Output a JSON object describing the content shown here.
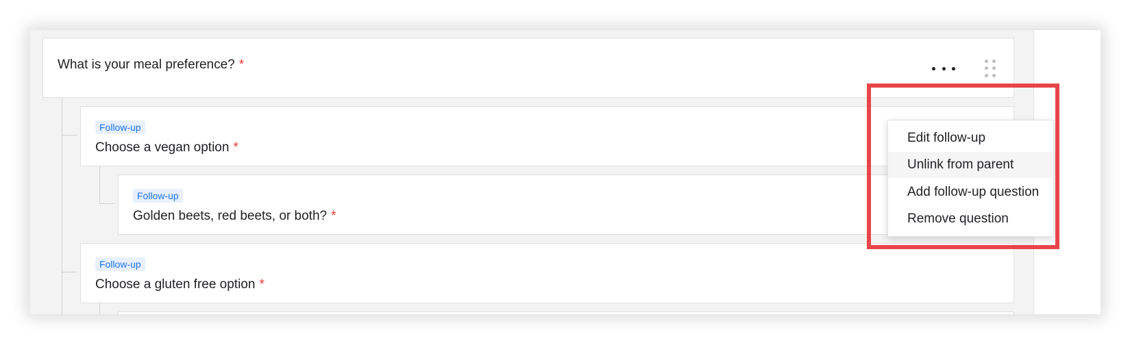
{
  "questions": {
    "main": {
      "text": "What is your meal preference?",
      "required_mark": "*"
    },
    "vegan": {
      "badge": "Follow-up",
      "text": "Choose a vegan option",
      "required_mark": "*"
    },
    "beets": {
      "badge": "Follow-up",
      "text": "Golden beets, red beets, or both?",
      "required_mark": "*"
    },
    "gluten": {
      "badge": "Follow-up",
      "text": "Choose a gluten free option",
      "required_mark": "*"
    }
  },
  "context_menu": {
    "items": [
      {
        "label": "Edit follow-up"
      },
      {
        "label": "Unlink from parent",
        "hovered": true
      },
      {
        "label": "Add follow-up question"
      },
      {
        "label": "Remove question"
      }
    ]
  },
  "colors": {
    "required": "#e53935",
    "badge_text": "#1a73e8",
    "badge_bg": "#e8f0fe",
    "highlight": "#e8454a"
  },
  "icons": {
    "more": "more-horizontal-icon",
    "drag": "drag-handle-icon"
  }
}
